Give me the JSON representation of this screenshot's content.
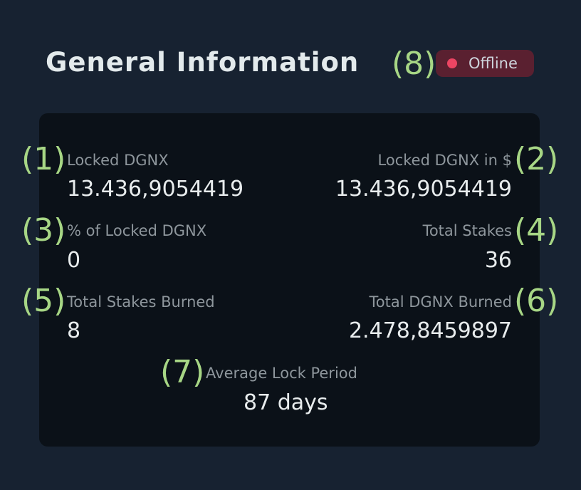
{
  "header": {
    "title": "General Information",
    "status_label": "Offline",
    "status_marker": "(8)",
    "status_color": "#ec4563"
  },
  "stats": [
    {
      "marker": "(1)",
      "label": "Locked DGNX",
      "value": "13.436,9054419"
    },
    {
      "marker": "(2)",
      "label": "Locked DGNX in $",
      "value": "13.436,9054419"
    },
    {
      "marker": "(3)",
      "label": "% of Locked DGNX",
      "value": "0"
    },
    {
      "marker": "(4)",
      "label": "Total Stakes",
      "value": "36"
    },
    {
      "marker": "(5)",
      "label": "Total Stakes Burned",
      "value": "8"
    },
    {
      "marker": "(6)",
      "label": "Total DGNX Burned",
      "value": "2.478,8459897"
    },
    {
      "marker": "(7)",
      "label": "Average Lock Period",
      "value": "87 days"
    }
  ],
  "colors": {
    "background": "#172231",
    "panel": "#0b1118",
    "marker": "#a7d685",
    "badge_bg": "#5a2030"
  }
}
